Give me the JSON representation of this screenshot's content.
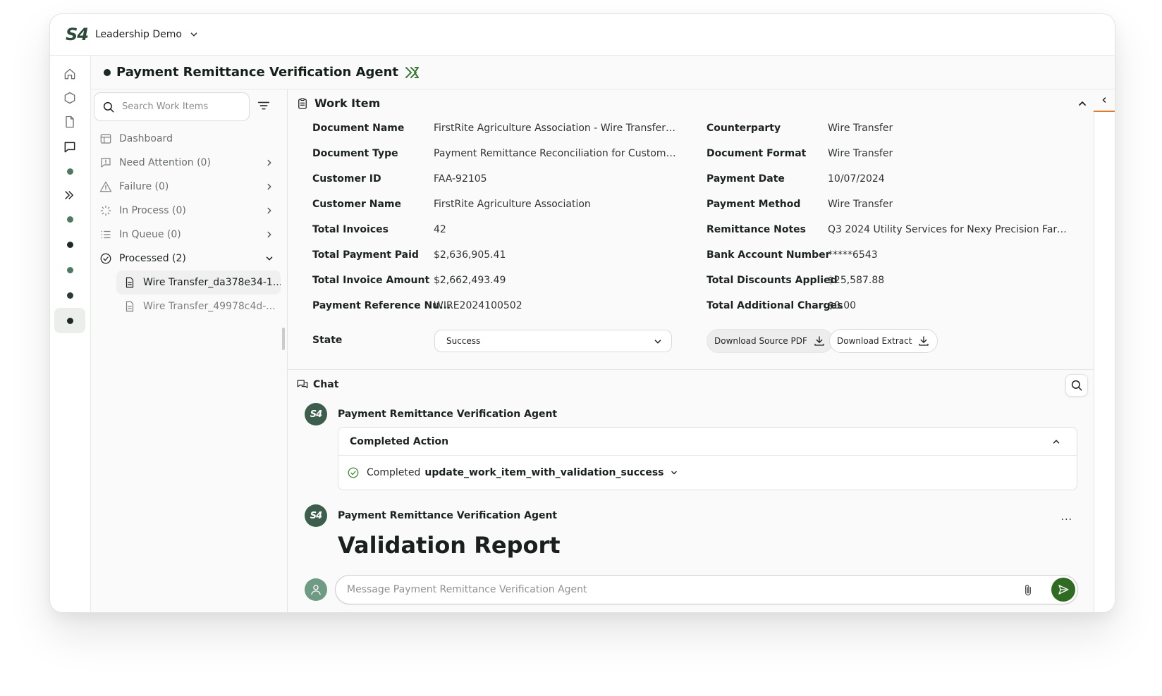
{
  "workspace": {
    "name": "Leadership Demo",
    "logo": "S4"
  },
  "page": {
    "title": "Payment Remittance Verification Agent"
  },
  "search": {
    "placeholder": "Search Work Items"
  },
  "nav": {
    "dashboard": "Dashboard",
    "need_attention": "Need Attention (0)",
    "failure": "Failure (0)",
    "in_process": "In Process (0)",
    "in_queue": "In Queue (0)",
    "processed": "Processed (2)",
    "items": [
      "Wire Transfer_da378e34-1...",
      "Wire Transfer_49978c4d-..."
    ]
  },
  "work_item": {
    "heading": "Work Item",
    "left_fields": [
      {
        "label": "Document Name",
        "value": "FirstRite Agriculture Association - Wire Transfer Pa..."
      },
      {
        "label": "Document Type",
        "value": "Payment Remittance Reconciliation for Customer T..."
      },
      {
        "label": "Customer ID",
        "value": "FAA-92105"
      },
      {
        "label": "Customer Name",
        "value": "FirstRite Agriculture Association"
      },
      {
        "label": "Total Invoices",
        "value": "42"
      },
      {
        "label": "Total Payment Paid",
        "value": "$2,636,905.41"
      },
      {
        "label": "Total Invoice Amount",
        "value": "$2,662,493.49"
      },
      {
        "label": "Payment Reference Nu...",
        "value": "WIRE2024100502"
      }
    ],
    "right_fields": [
      {
        "label": "Counterparty",
        "value": "Wire Transfer"
      },
      {
        "label": "Document Format",
        "value": "Wire Transfer"
      },
      {
        "label": "Payment Date",
        "value": "10/07/2024"
      },
      {
        "label": "Payment Method",
        "value": "Wire Transfer"
      },
      {
        "label": "Remittance Notes",
        "value": "Q3 2024 Utility Services for Nexy Precision Farmin..."
      },
      {
        "label": "Bank Account Number",
        "value": "*****6543"
      },
      {
        "label": "Total Discounts Applied",
        "value": "$25,587.88"
      },
      {
        "label": "Total Additional Charges",
        "value": "$0.00"
      }
    ],
    "state_label": "State",
    "state_value": "Success",
    "download_source": "Download Source PDF",
    "download_extract": "Download Extract"
  },
  "chat": {
    "heading": "Chat",
    "agent_name": "Payment Remittance Verification Agent",
    "action_title": "Completed Action",
    "action_status": "Completed",
    "action_name": "update_work_item_with_validation_success",
    "report_title": "Validation Report",
    "more": "···",
    "message_placeholder": "Message Payment Remittance Verification Agent"
  },
  "colors": {
    "accent": "#2f6b22",
    "brand": "#2c4a3a",
    "tab_indicator": "#e07a2a"
  }
}
